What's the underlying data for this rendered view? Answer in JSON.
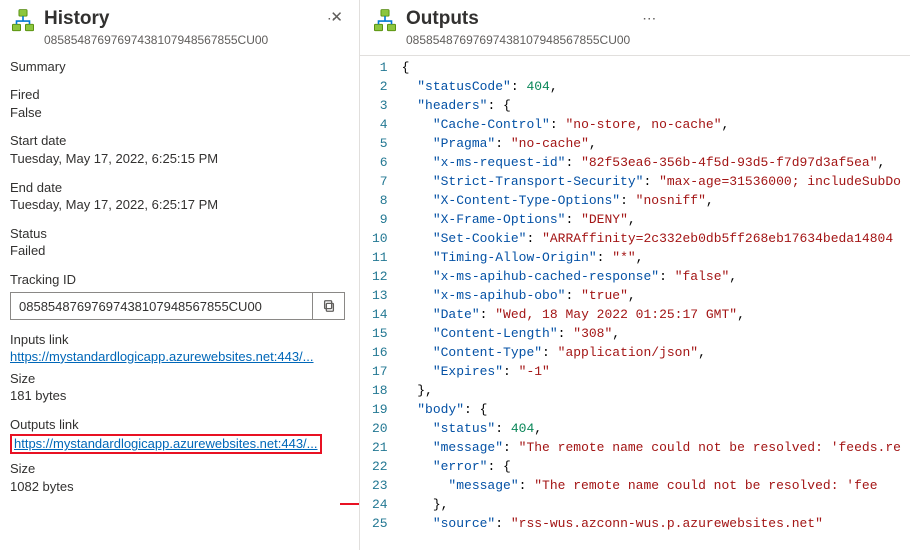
{
  "history": {
    "title": "History",
    "run_id": "08585487697697438107948567855CU00",
    "summary_label": "Summary",
    "fired_label": "Fired",
    "fired_value": "False",
    "start_label": "Start date",
    "start_value": "Tuesday, May 17, 2022, 6:25:15 PM",
    "end_label": "End date",
    "end_value": "Tuesday, May 17, 2022, 6:25:17 PM",
    "status_label": "Status",
    "status_value": "Failed",
    "tracking_label": "Tracking ID",
    "tracking_value": "08585487697697438107948567855CU00",
    "inputs_link_label": "Inputs link",
    "inputs_link_value": "https://mystandardlogicapp.azurewebsites.net:443/...",
    "inputs_size_label": "Size",
    "inputs_size_value": "181 bytes",
    "outputs_link_label": "Outputs link",
    "outputs_link_value": "https://mystandardlogicapp.azurewebsites.net:443/...",
    "outputs_size_label": "Size",
    "outputs_size_value": "1082 bytes"
  },
  "outputs": {
    "title": "Outputs",
    "run_id": "08585487697697438107948567855CU00"
  },
  "code_lines": [
    [
      {
        "c": "t-brace",
        "t": "{"
      }
    ],
    [
      {
        "c": "",
        "t": "  "
      },
      {
        "c": "t-key",
        "t": "\"statusCode\""
      },
      {
        "c": "t-punct",
        "t": ": "
      },
      {
        "c": "t-num",
        "t": "404"
      },
      {
        "c": "t-punct",
        "t": ","
      }
    ],
    [
      {
        "c": "",
        "t": "  "
      },
      {
        "c": "t-key",
        "t": "\"headers\""
      },
      {
        "c": "t-punct",
        "t": ": {"
      }
    ],
    [
      {
        "c": "",
        "t": "    "
      },
      {
        "c": "t-key",
        "t": "\"Cache-Control\""
      },
      {
        "c": "t-punct",
        "t": ": "
      },
      {
        "c": "t-str",
        "t": "\"no-store, no-cache\""
      },
      {
        "c": "t-punct",
        "t": ","
      }
    ],
    [
      {
        "c": "",
        "t": "    "
      },
      {
        "c": "t-key",
        "t": "\"Pragma\""
      },
      {
        "c": "t-punct",
        "t": ": "
      },
      {
        "c": "t-str",
        "t": "\"no-cache\""
      },
      {
        "c": "t-punct",
        "t": ","
      }
    ],
    [
      {
        "c": "",
        "t": "    "
      },
      {
        "c": "t-key",
        "t": "\"x-ms-request-id\""
      },
      {
        "c": "t-punct",
        "t": ": "
      },
      {
        "c": "t-str",
        "t": "\"82f53ea6-356b-4f5d-93d5-f7d97d3af5ea\""
      },
      {
        "c": "t-punct",
        "t": ","
      }
    ],
    [
      {
        "c": "",
        "t": "    "
      },
      {
        "c": "t-key",
        "t": "\"Strict-Transport-Security\""
      },
      {
        "c": "t-punct",
        "t": ": "
      },
      {
        "c": "t-str",
        "t": "\"max-age=31536000; includeSubDo"
      }
    ],
    [
      {
        "c": "",
        "t": "    "
      },
      {
        "c": "t-key",
        "t": "\"X-Content-Type-Options\""
      },
      {
        "c": "t-punct",
        "t": ": "
      },
      {
        "c": "t-str",
        "t": "\"nosniff\""
      },
      {
        "c": "t-punct",
        "t": ","
      }
    ],
    [
      {
        "c": "",
        "t": "    "
      },
      {
        "c": "t-key",
        "t": "\"X-Frame-Options\""
      },
      {
        "c": "t-punct",
        "t": ": "
      },
      {
        "c": "t-str",
        "t": "\"DENY\""
      },
      {
        "c": "t-punct",
        "t": ","
      }
    ],
    [
      {
        "c": "",
        "t": "    "
      },
      {
        "c": "t-key",
        "t": "\"Set-Cookie\""
      },
      {
        "c": "t-punct",
        "t": ": "
      },
      {
        "c": "t-str",
        "t": "\"ARRAffinity=2c332eb0db5ff268eb17634beda14804"
      }
    ],
    [
      {
        "c": "",
        "t": "    "
      },
      {
        "c": "t-key",
        "t": "\"Timing-Allow-Origin\""
      },
      {
        "c": "t-punct",
        "t": ": "
      },
      {
        "c": "t-str",
        "t": "\"*\""
      },
      {
        "c": "t-punct",
        "t": ","
      }
    ],
    [
      {
        "c": "",
        "t": "    "
      },
      {
        "c": "t-key",
        "t": "\"x-ms-apihub-cached-response\""
      },
      {
        "c": "t-punct",
        "t": ": "
      },
      {
        "c": "t-str",
        "t": "\"false\""
      },
      {
        "c": "t-punct",
        "t": ","
      }
    ],
    [
      {
        "c": "",
        "t": "    "
      },
      {
        "c": "t-key",
        "t": "\"x-ms-apihub-obo\""
      },
      {
        "c": "t-punct",
        "t": ": "
      },
      {
        "c": "t-str",
        "t": "\"true\""
      },
      {
        "c": "t-punct",
        "t": ","
      }
    ],
    [
      {
        "c": "",
        "t": "    "
      },
      {
        "c": "t-key",
        "t": "\"Date\""
      },
      {
        "c": "t-punct",
        "t": ": "
      },
      {
        "c": "t-str",
        "t": "\"Wed, 18 May 2022 01:25:17 GMT\""
      },
      {
        "c": "t-punct",
        "t": ","
      }
    ],
    [
      {
        "c": "",
        "t": "    "
      },
      {
        "c": "t-key",
        "t": "\"Content-Length\""
      },
      {
        "c": "t-punct",
        "t": ": "
      },
      {
        "c": "t-str",
        "t": "\"308\""
      },
      {
        "c": "t-punct",
        "t": ","
      }
    ],
    [
      {
        "c": "",
        "t": "    "
      },
      {
        "c": "t-key",
        "t": "\"Content-Type\""
      },
      {
        "c": "t-punct",
        "t": ": "
      },
      {
        "c": "t-str",
        "t": "\"application/json\""
      },
      {
        "c": "t-punct",
        "t": ","
      }
    ],
    [
      {
        "c": "",
        "t": "    "
      },
      {
        "c": "t-key",
        "t": "\"Expires\""
      },
      {
        "c": "t-punct",
        "t": ": "
      },
      {
        "c": "t-str",
        "t": "\"-1\""
      }
    ],
    [
      {
        "c": "",
        "t": "  "
      },
      {
        "c": "t-brace",
        "t": "},"
      }
    ],
    [
      {
        "c": "",
        "t": "  "
      },
      {
        "c": "t-key",
        "t": "\"body\""
      },
      {
        "c": "t-punct",
        "t": ": {"
      }
    ],
    [
      {
        "c": "",
        "t": "    "
      },
      {
        "c": "t-key",
        "t": "\"status\""
      },
      {
        "c": "t-punct",
        "t": ": "
      },
      {
        "c": "t-num",
        "t": "404"
      },
      {
        "c": "t-punct",
        "t": ","
      }
    ],
    [
      {
        "c": "",
        "t": "    "
      },
      {
        "c": "t-key",
        "t": "\"message\""
      },
      {
        "c": "t-punct",
        "t": ": "
      },
      {
        "c": "t-str",
        "t": "\"The remote name could not be resolved: 'feeds.re"
      }
    ],
    [
      {
        "c": "",
        "t": "    "
      },
      {
        "c": "t-key",
        "t": "\"error\""
      },
      {
        "c": "t-punct",
        "t": ": {"
      }
    ],
    [
      {
        "c": "",
        "t": "      "
      },
      {
        "c": "t-key",
        "t": "\"message\""
      },
      {
        "c": "t-punct",
        "t": ": "
      },
      {
        "c": "t-str",
        "t": "\"The remote name could not be resolved: 'fee"
      }
    ],
    [
      {
        "c": "",
        "t": "    "
      },
      {
        "c": "t-brace",
        "t": "},"
      }
    ],
    [
      {
        "c": "",
        "t": "    "
      },
      {
        "c": "t-key",
        "t": "\"source\""
      },
      {
        "c": "t-punct",
        "t": ": "
      },
      {
        "c": "t-str",
        "t": "\"rss-wus.azconn-wus.p.azurewebsites.net\""
      }
    ]
  ]
}
